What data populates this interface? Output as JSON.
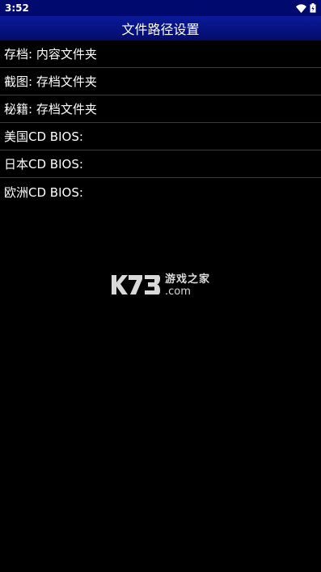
{
  "status_bar": {
    "time": "3:52",
    "wifi_icon": "wifi-icon",
    "battery_icon": "battery-icon"
  },
  "header": {
    "title": "文件路径设置"
  },
  "settings_list": [
    {
      "label": "存档: 内容文件夹"
    },
    {
      "label": "截图: 存档文件夹"
    },
    {
      "label": "秘籍: 存档文件夹"
    },
    {
      "label": "美国CD BIOS:"
    },
    {
      "label": "日本CD BIOS:"
    },
    {
      "label": "欧洲CD BIOS:"
    }
  ],
  "watermark": {
    "logo_text": "K73",
    "line1": "游戏之家",
    "line2": ".com"
  },
  "colors": {
    "status_bar_bg": "#000a6e",
    "title_bar_bg": "#0a1a9a",
    "background": "#000000",
    "text": "#ffffff",
    "divider": "#3a3a3a"
  }
}
